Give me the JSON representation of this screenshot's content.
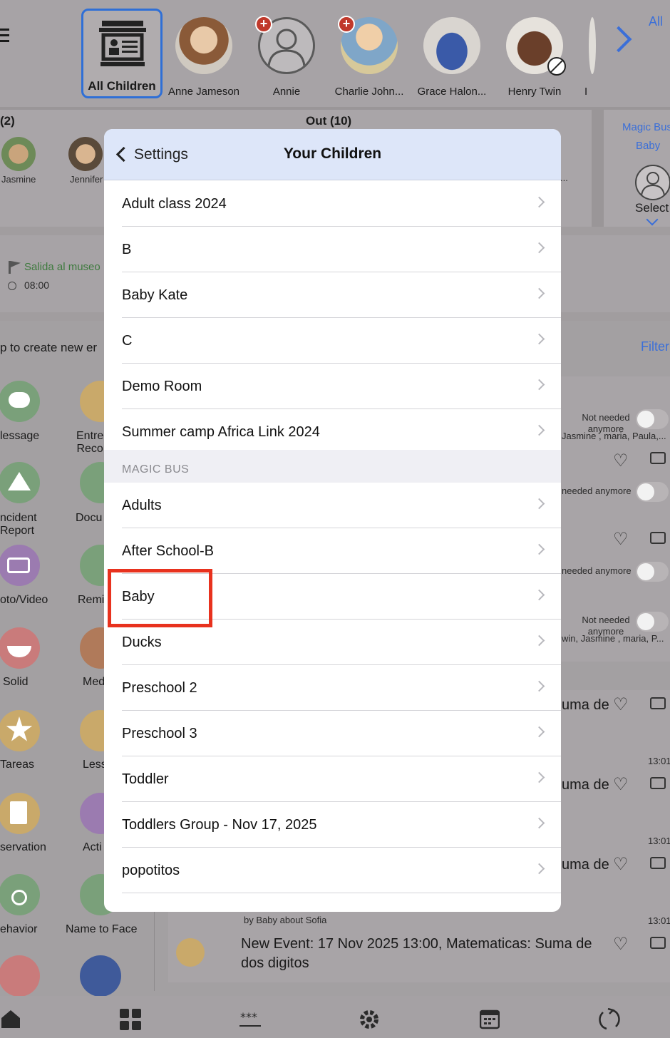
{
  "top": {
    "all_label": "All",
    "children": [
      {
        "name": "All Children"
      },
      {
        "name": "Anne Jameson"
      },
      {
        "name": "Annie"
      },
      {
        "name": "Charlie John..."
      },
      {
        "name": "Grace Halon..."
      },
      {
        "name": "Henry Twin"
      },
      {
        "name": "I"
      }
    ]
  },
  "panels": {
    "in_title": "(2)",
    "in_children": [
      "Jasmine",
      "Jennifer"
    ],
    "out_title": "Out (10)",
    "out_ellipsis": "...",
    "bus_title_line1": "Magic Bus",
    "bus_title_line2": "Baby",
    "bus_select": "Select"
  },
  "event": {
    "title": "Salida al museo",
    "time": "08:00"
  },
  "create": {
    "hint": "p to create new er",
    "filter": "Filter"
  },
  "activities": [
    {
      "label": "lessage",
      "color": "#7aa07a"
    },
    {
      "label": "Entre\nReco",
      "color": "#c9a96a"
    },
    {
      "label": "ncident\nReport",
      "color": "#7aa07a"
    },
    {
      "label": "Docu",
      "color": "#7aa07a"
    },
    {
      "label": "oto/Video",
      "color": "#9b7bb0"
    },
    {
      "label": "Remi",
      "color": "#7aa07a"
    },
    {
      "label": "Solid",
      "color": "#c97b7b"
    },
    {
      "label": "Med",
      "color": "#b07a5a"
    },
    {
      "label": "Tareas",
      "color": "#c9a96a"
    },
    {
      "label": "Less",
      "color": "#c9a96a"
    },
    {
      "label": "servation",
      "color": "#c9a96a"
    },
    {
      "label": "Acti",
      "color": "#9b7bb0"
    },
    {
      "label": "ehavior",
      "color": "#7aa07a"
    },
    {
      "label": "Name to Face",
      "color": "#7aa07a"
    }
  ],
  "feed": {
    "not_needed_1": "Not needed anymore",
    "kids_1": "Jasmine , maria, Paula,...",
    "not_needed_2": "needed anymore",
    "not_needed_3": "needed anymore",
    "not_needed_4": "Not needed anymore",
    "kids_4": "win, Jasmine , maria, P...",
    "suma": "uma de",
    "time": "13:01",
    "by": "by Baby about Sofia",
    "new_event_line1": "New Event: 17 Nov 2025 13:00, Matematicas: Suma de",
    "new_event_line2": "dos digitos"
  },
  "modal": {
    "back_label": "Settings",
    "title": "Your Children",
    "group1": [
      "Adult class 2024",
      "B",
      "Baby Kate",
      "C",
      "Demo Room",
      "Summer camp Africa Link 2024"
    ],
    "section_header": "MAGIC BUS",
    "group2": [
      "Adults",
      "After School-B",
      "Baby",
      "Ducks",
      "Preschool 2",
      "Preschool 3",
      "Toddler",
      "Toddlers Group - Nov 17, 2025",
      "popotitos"
    ]
  },
  "tabbar": {
    "icons": [
      "home-icon",
      "grid-icon",
      "password-icon",
      "gear-icon",
      "calendar-icon",
      "sync-icon"
    ]
  }
}
